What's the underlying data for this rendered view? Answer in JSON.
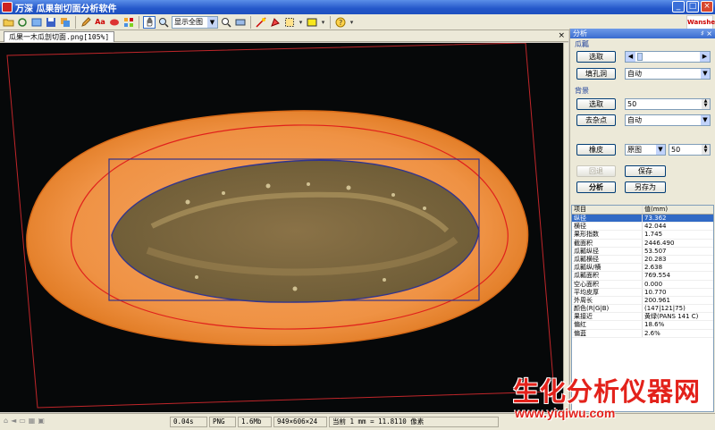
{
  "window": {
    "title": "万深  瓜果剖切面分析软件",
    "minimize": "_",
    "maximize": "□",
    "close": "×"
  },
  "toolbar": {
    "zoom_option": "显示全图",
    "logo_text": "Wanshen"
  },
  "document": {
    "tab_title": "瓜果一木瓜剖切面.png[105%]",
    "close": "×"
  },
  "panel": {
    "title": "分析",
    "pins": "♯ ×",
    "pulp_group": "瓜瓤",
    "pulp_select_button": "选取",
    "fill_holes_button": "填孔洞",
    "fill_holes_value": "自动",
    "background_group": "背景",
    "bg_select_button": "选取",
    "bg_select_value": "50",
    "remove_noise_button": "去杂点",
    "remove_noise_value": "自动",
    "peel_button": "橡皮",
    "peel_mode": "原图",
    "peel_value": "50",
    "undo_button": "回退",
    "save_button": "保存",
    "analyze_button": "分析",
    "save_as_button": "另存为"
  },
  "results": {
    "headers": [
      "项目",
      "值(mm)"
    ],
    "rows": [
      {
        "item": "纵径",
        "value": "73.362"
      },
      {
        "item": "横径",
        "value": "42.044"
      },
      {
        "item": "果形指数",
        "value": "1.745"
      },
      {
        "item": "截面积",
        "value": "2446.490"
      },
      {
        "item": "瓜瓤纵径",
        "value": "53.507"
      },
      {
        "item": "瓜瓤横径",
        "value": "20.283"
      },
      {
        "item": "瓜瓤纵/横",
        "value": "2.638"
      },
      {
        "item": "瓜瓤面积",
        "value": "769.554"
      },
      {
        "item": "空心面积",
        "value": "0.000"
      },
      {
        "item": "平均皮厚",
        "value": "10.770"
      },
      {
        "item": "外周长",
        "value": "200.961"
      },
      {
        "item": "颜色(R|G|B)",
        "value": "(147|121|75)"
      },
      {
        "item": "果接近",
        "value": "黄绿(PANS 141 C)"
      },
      {
        "item": "偏红",
        "value": "18.6%"
      },
      {
        "item": "偏蓝",
        "value": "2.6%"
      }
    ]
  },
  "status": {
    "time": "0.04s",
    "format": "PNG",
    "size": "1.6Mb",
    "dimensions": "949×606×24",
    "scale": "当前 1 mm = 11.8110 像素"
  },
  "watermark": {
    "cn": "生化分析仪器网",
    "url": "www.yiqiwu.com"
  }
}
